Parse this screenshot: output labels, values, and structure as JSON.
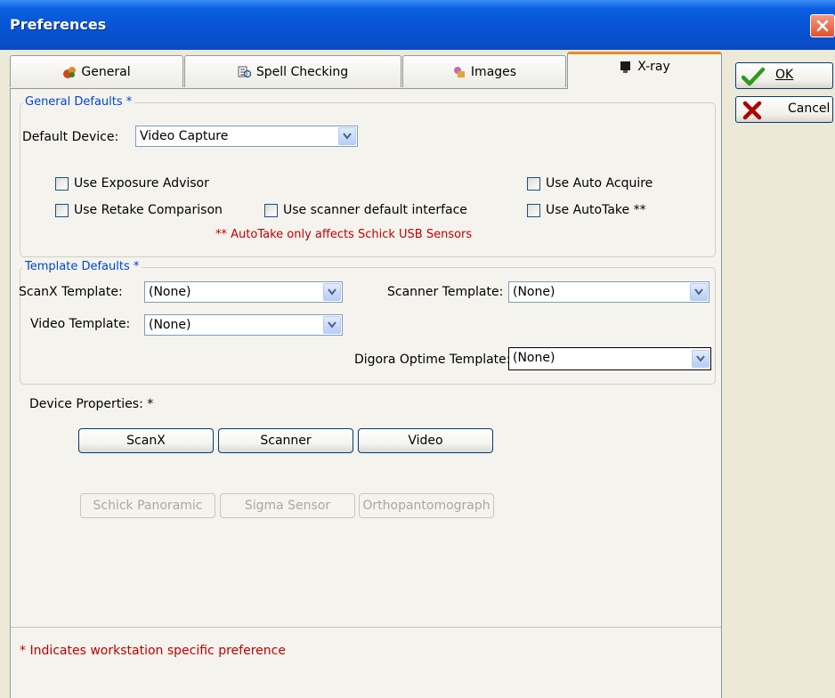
{
  "window": {
    "title": "Preferences"
  },
  "tabs": [
    {
      "label": "General",
      "icon": "general-icon"
    },
    {
      "label": "Spell Checking",
      "icon": "spell-check-icon"
    },
    {
      "label": "Images",
      "icon": "images-icon"
    },
    {
      "label": "X-ray",
      "icon": "xray-icon",
      "active": true
    }
  ],
  "side_buttons": {
    "ok": "OK",
    "cancel": "Cancel"
  },
  "general_defaults": {
    "legend": "General Defaults *",
    "default_device_label": "Default Device:",
    "default_device_value": "Video Capture",
    "use_exposure_advisor": "Use Exposure Advisor",
    "use_retake_comparison": "Use Retake Comparison",
    "use_scanner_default_interface": "Use scanner default interface",
    "use_auto_acquire": "Use Auto Acquire",
    "use_autotake": "Use AutoTake **",
    "autotake_note": "** AutoTake only affects Schick USB Sensors"
  },
  "template_defaults": {
    "legend": "Template Defaults *",
    "scanx_label": "ScanX Template:",
    "scanx_value": "(None)",
    "scanner_label": "Scanner Template:",
    "scanner_value": "(None)",
    "video_label": "Video Template:",
    "video_value": "(None)",
    "digora_label": "Digora Optime Template:",
    "digora_value": "(None)"
  },
  "device_properties": {
    "label": "Device Properties: *",
    "buttons": [
      "ScanX",
      "Scanner",
      "Video"
    ],
    "disabled_buttons": [
      "Schick Panoramic",
      "Sigma Sensor",
      "Orthopantomograph"
    ]
  },
  "footer_note": "* Indicates workstation specific preference",
  "colors": {
    "title_bar": "#0753d4",
    "group_legend": "#0046d5",
    "note_red": "#c00000",
    "active_tab_accent": "#e68b2c"
  }
}
